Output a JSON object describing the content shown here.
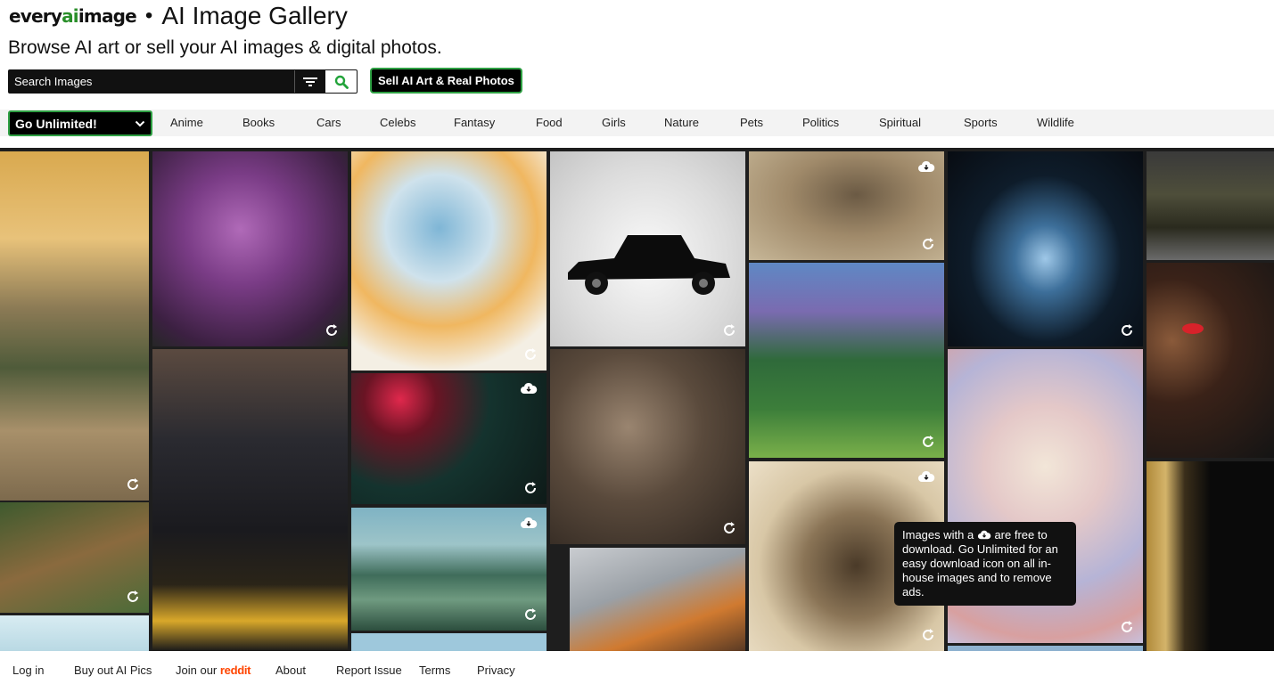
{
  "header": {
    "logo_every": "every",
    "logo_ai": "ai",
    "logo_image": "image",
    "separator": "•",
    "title": "AI Image Gallery",
    "tagline": "Browse AI art or sell your AI images & digital photos."
  },
  "search": {
    "placeholder": "Search Images",
    "filter_icon": "filter-icon",
    "search_icon": "search-icon"
  },
  "sell_button": "Sell AI Art & Real Photos",
  "unlimited_select": "Go Unlimited!",
  "categories": [
    "Anime",
    "Books",
    "Cars",
    "Celebs",
    "Fantasy",
    "Food",
    "Girls",
    "Nature",
    "Pets",
    "Politics",
    "Spiritual",
    "Sports",
    "Wildlife"
  ],
  "tooltip": {
    "text_before": "Images with a",
    "text_after": "are free to download. Go Unlimited for an easy download icon on all in-house images and to remove ads."
  },
  "footer": {
    "login": "Log in",
    "buyout": "Buy out AI Pics",
    "join": "Join our",
    "reddit": "reddit",
    "about": "About",
    "report": "Report Issue",
    "terms": "Terms",
    "privacy": "Privacy"
  },
  "colors": {
    "accent_green": "#2ea043",
    "reddit_orange": "#ff4500"
  }
}
